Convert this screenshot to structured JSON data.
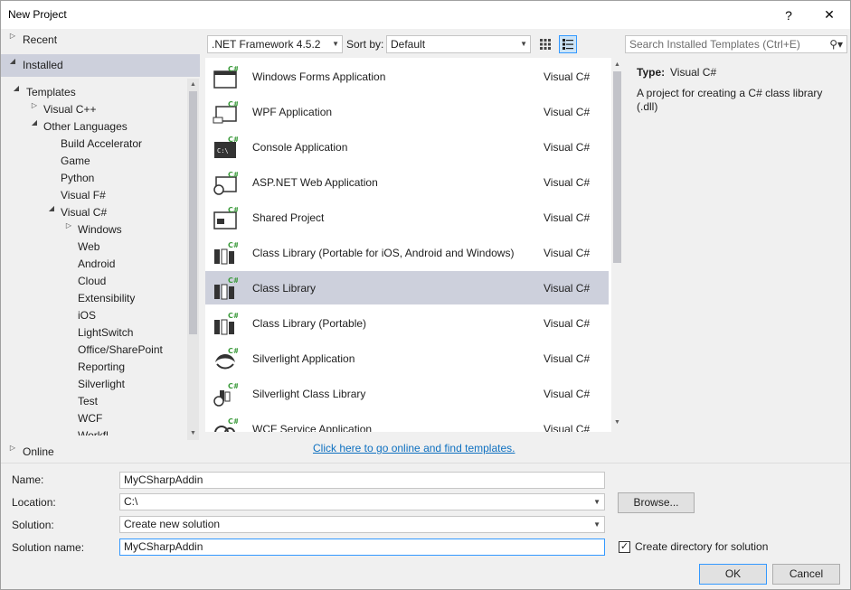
{
  "window": {
    "title": "New Project",
    "help_label": "?",
    "close_label": "✕"
  },
  "nav": {
    "recent": "Recent",
    "installed": "Installed",
    "templates": "Templates",
    "visual_cpp": "Visual C++",
    "other_languages": "Other Languages",
    "build_accelerator": "Build Accelerator",
    "game": "Game",
    "python": "Python",
    "visual_fsharp": "Visual F#",
    "visual_csharp": "Visual C#",
    "windows": "Windows",
    "web": "Web",
    "android": "Android",
    "cloud": "Cloud",
    "extensibility": "Extensibility",
    "ios": "iOS",
    "lightswitch": "LightSwitch",
    "office_sharepoint": "Office/SharePoint",
    "reporting": "Reporting",
    "silverlight": "Silverlight",
    "test": "Test",
    "wcf": "WCF",
    "workflow_partial": "Workfl...",
    "online": "Online"
  },
  "toolbar": {
    "framework": ".NET Framework 4.5.2",
    "sort_by_label": "Sort by:",
    "sort_value": "Default",
    "search_placeholder": "Search Installed Templates (Ctrl+E)"
  },
  "templates": [
    {
      "name": "Windows Forms Application",
      "lang": "Visual C#",
      "icon": "windows-forms-icon"
    },
    {
      "name": "WPF Application",
      "lang": "Visual C#",
      "icon": "wpf-icon"
    },
    {
      "name": "Console Application",
      "lang": "Visual C#",
      "icon": "console-icon"
    },
    {
      "name": "ASP.NET Web Application",
      "lang": "Visual C#",
      "icon": "web-app-icon"
    },
    {
      "name": "Shared Project",
      "lang": "Visual C#",
      "icon": "shared-project-icon"
    },
    {
      "name": "Class Library (Portable for iOS, Android and Windows)",
      "lang": "Visual C#",
      "icon": "class-library-icon"
    },
    {
      "name": "Class Library",
      "lang": "Visual C#",
      "icon": "class-library-icon",
      "selected": true
    },
    {
      "name": "Class Library (Portable)",
      "lang": "Visual C#",
      "icon": "class-library-icon"
    },
    {
      "name": "Silverlight Application",
      "lang": "Visual C#",
      "icon": "silverlight-icon"
    },
    {
      "name": "Silverlight Class Library",
      "lang": "Visual C#",
      "icon": "silverlight-library-icon"
    },
    {
      "name": "WCF Service Application",
      "lang": "Visual C#",
      "icon": "wcf-icon"
    }
  ],
  "details": {
    "type_label": "Type:",
    "type_value": "Visual C#",
    "description": "A project for creating a C# class library (.dll)"
  },
  "online_link": "Click here to go online and find templates.",
  "form": {
    "name_label": "Name:",
    "name_value": "MyCSharpAddin",
    "location_label": "Location:",
    "location_value": "C:\\",
    "browse_label": "Browse...",
    "solution_label": "Solution:",
    "solution_value": "Create new solution",
    "solution_name_label": "Solution name:",
    "solution_name_value": "MyCSharpAddin",
    "create_dir_label": "Create directory for solution",
    "create_dir_checked": true,
    "ok_label": "OK",
    "cancel_label": "Cancel"
  },
  "colors": {
    "selection": "#cdd0dc",
    "accent": "#3399ff",
    "link": "#0e70c0",
    "csharp_green": "#3a9a3a"
  }
}
